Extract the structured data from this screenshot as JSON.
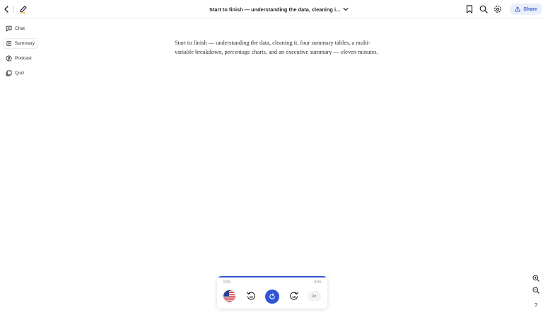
{
  "header": {
    "title": "Start to finish — understanding the data, cleaning i...",
    "share_label": "Share",
    "icons": [
      "chevron-left-icon",
      "edit-icon",
      "chevron-down-icon",
      "bookmark-icon",
      "search-icon",
      "gear-icon",
      "share-icon"
    ]
  },
  "sidebar": {
    "items": [
      {
        "label": "Chat",
        "icon": "chat-icon"
      },
      {
        "label": "Summary",
        "icon": "summary-icon",
        "active": true
      },
      {
        "label": "Podcast",
        "icon": "podcast-icon"
      },
      {
        "label": "Quiz",
        "icon": "quiz-icon"
      }
    ]
  },
  "main": {
    "summary_text": "Start to finish — understanding the data, cleaning it, four summary tables, a multi-variable breakdown, percentage charts, and an executive summary — eleven minutes."
  },
  "player": {
    "elapsed": "0:09",
    "duration": "0:09",
    "progress": 1.0,
    "rewind_label": "10",
    "forward_label": "10",
    "speed": "1×",
    "voice_flag": "us-flag-icon"
  },
  "controls": {
    "help_label": "?"
  },
  "colors": {
    "accent": "#2f55d4",
    "share_bg": "#e9effb",
    "share_text": "#3860c9"
  }
}
